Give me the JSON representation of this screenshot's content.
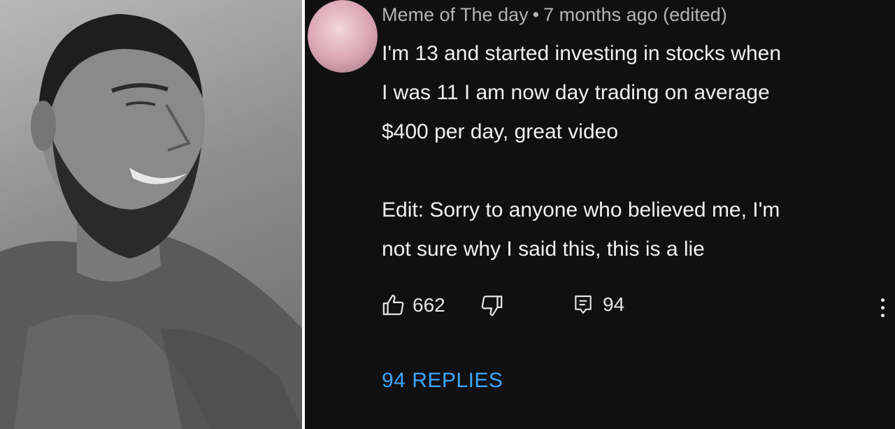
{
  "comment": {
    "author": "Meme of The day",
    "separator": "•",
    "time": "7 months ago (edited)",
    "lines": [
      "I'm 13 and started investing in stocks when",
      "I was 11 I am now day trading on average",
      "$400 per day, great video",
      "Edit: Sorry to anyone who believed me, I'm",
      "not sure why I said this, this is a lie"
    ],
    "likes": "662",
    "reply_count": "94",
    "replies_link": "94 REPLIES"
  },
  "icons": {
    "like": "thumbs-up-icon",
    "dislike": "thumbs-down-icon",
    "reply": "comment-icon",
    "more": "more-vertical-icon"
  },
  "colors": {
    "panel_bg": "#101010",
    "text": "#f0f0f0",
    "meta": "#b5b5b5",
    "link": "#3ea6ff"
  }
}
